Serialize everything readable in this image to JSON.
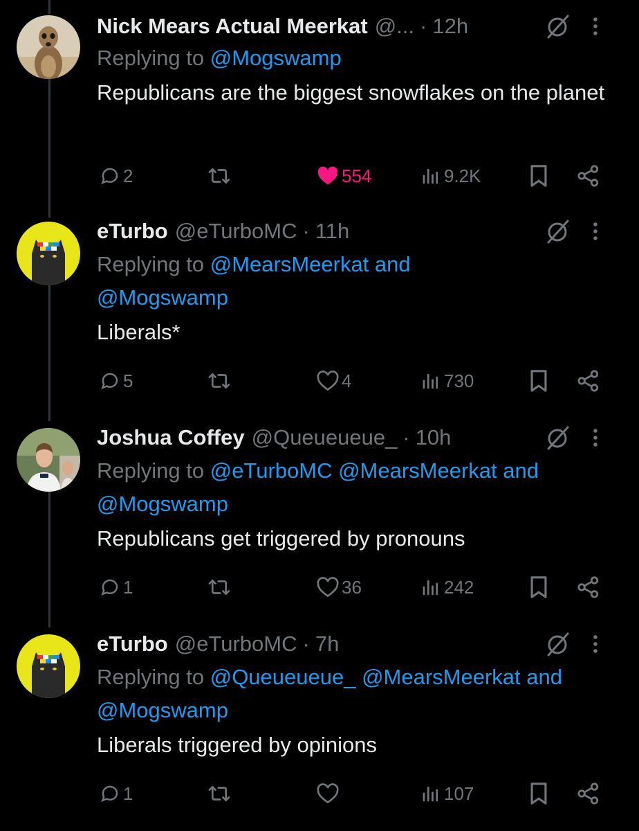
{
  "colors": {
    "background": "#000000",
    "text": "#e7e9ea",
    "muted": "#71767b",
    "link": "#1d9bf0",
    "like": "#f91880"
  },
  "tweets": [
    {
      "name": "Nick Mears Actual Meerkat",
      "handle": "@...",
      "time": "12h",
      "replying_label": "Replying to",
      "mentions": "@Mogswamp",
      "text": "Republicans are the biggest snowflakes on the planet",
      "replies": "2",
      "retweets": "",
      "likes": "554",
      "liked": true,
      "views": "9.2K",
      "avatar": "meerkat-avatar"
    },
    {
      "name": "eTurbo",
      "handle": "@eTurboMC",
      "time": "11h",
      "replying_label": "Replying to",
      "mentions": "@MearsMeerkat and @Mogswamp",
      "text": "Liberals*",
      "replies": "5",
      "retweets": "",
      "likes": "4",
      "liked": false,
      "views": "730",
      "avatar": "cat-avatar"
    },
    {
      "name": "Joshua Coffey",
      "handle": "@Queueueue_",
      "time": "10h",
      "replying_label": "Replying to",
      "mentions": "@eTurboMC @MearsMeerkat and @Mogswamp",
      "text": "Republicans get triggered by pronouns",
      "replies": "1",
      "retweets": "",
      "likes": "36",
      "liked": false,
      "views": "242",
      "avatar": "person-avatar"
    },
    {
      "name": "eTurbo",
      "handle": "@eTurboMC",
      "time": "7h",
      "replying_label": "Replying to",
      "mentions": "@Queueueue_ @MearsMeerkat and @Mogswamp",
      "text": "Liberals triggered by opinions",
      "replies": "1",
      "retweets": "",
      "likes": "",
      "liked": false,
      "views": "107",
      "avatar": "cat-avatar"
    }
  ]
}
